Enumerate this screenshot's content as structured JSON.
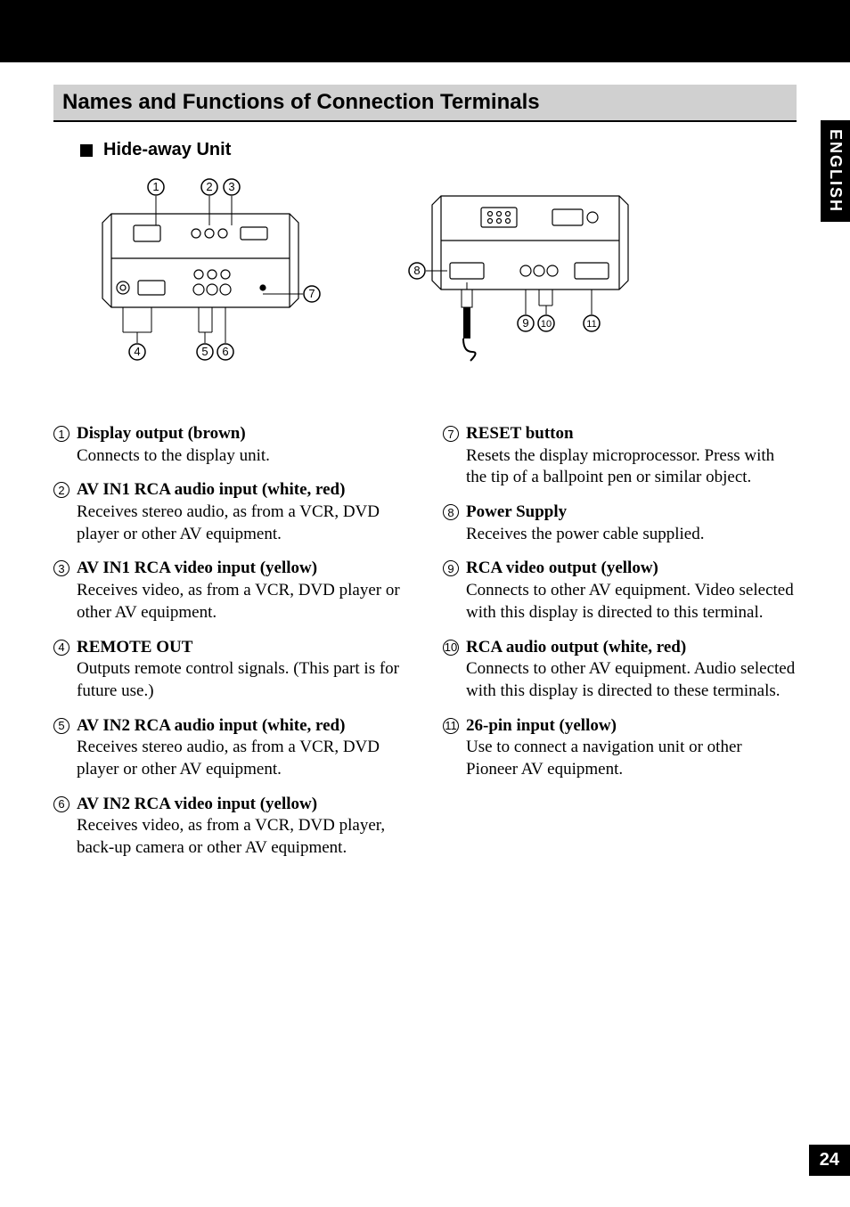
{
  "sideTab": "ENGLISH",
  "pageNumber": "24",
  "sectionTitle": "Names and Functions of Connection Terminals",
  "subsectionTitle": "Hide-away Unit",
  "diagram1": {
    "callouts": [
      "1",
      "2",
      "3",
      "4",
      "5",
      "6",
      "7"
    ]
  },
  "diagram2": {
    "callouts": [
      "8",
      "9",
      "10",
      "11"
    ]
  },
  "leftColumn": [
    {
      "num": "1",
      "title": "Display output (brown)",
      "desc": "Connects to the display unit."
    },
    {
      "num": "2",
      "title": "AV IN1 RCA audio input (white, red)",
      "desc": "Receives stereo audio, as from a VCR, DVD player or other AV equipment."
    },
    {
      "num": "3",
      "title": "AV IN1 RCA video input (yellow)",
      "desc": "Receives video, as from a VCR, DVD player or other AV equipment."
    },
    {
      "num": "4",
      "title": "REMOTE OUT",
      "desc": "Outputs remote control signals. (This part is for future use.)"
    },
    {
      "num": "5",
      "title": "AV IN2 RCA audio input (white, red)",
      "desc": "Receives stereo audio, as from a VCR, DVD player or other AV equipment."
    },
    {
      "num": "6",
      "title": "AV IN2 RCA video input (yellow)",
      "desc": "Receives video, as from a VCR, DVD player, back-up camera or other AV equipment."
    }
  ],
  "rightColumn": [
    {
      "num": "7",
      "title": "RESET button",
      "desc": "Resets the display microprocessor. Press with the tip of a ballpoint pen or similar object."
    },
    {
      "num": "8",
      "title": "Power Supply",
      "desc": "Receives the power cable supplied."
    },
    {
      "num": "9",
      "title": "RCA video output (yellow)",
      "desc": "Connects to other AV equipment. Video selected with this display is directed to this terminal."
    },
    {
      "num": "10",
      "title": "RCA audio output (white, red)",
      "desc": "Connects to other AV equipment. Audio selected with this display is directed to these terminals."
    },
    {
      "num": "11",
      "title": "26-pin input (yellow)",
      "desc": "Use to connect a navigation unit or other Pioneer AV equipment."
    }
  ]
}
